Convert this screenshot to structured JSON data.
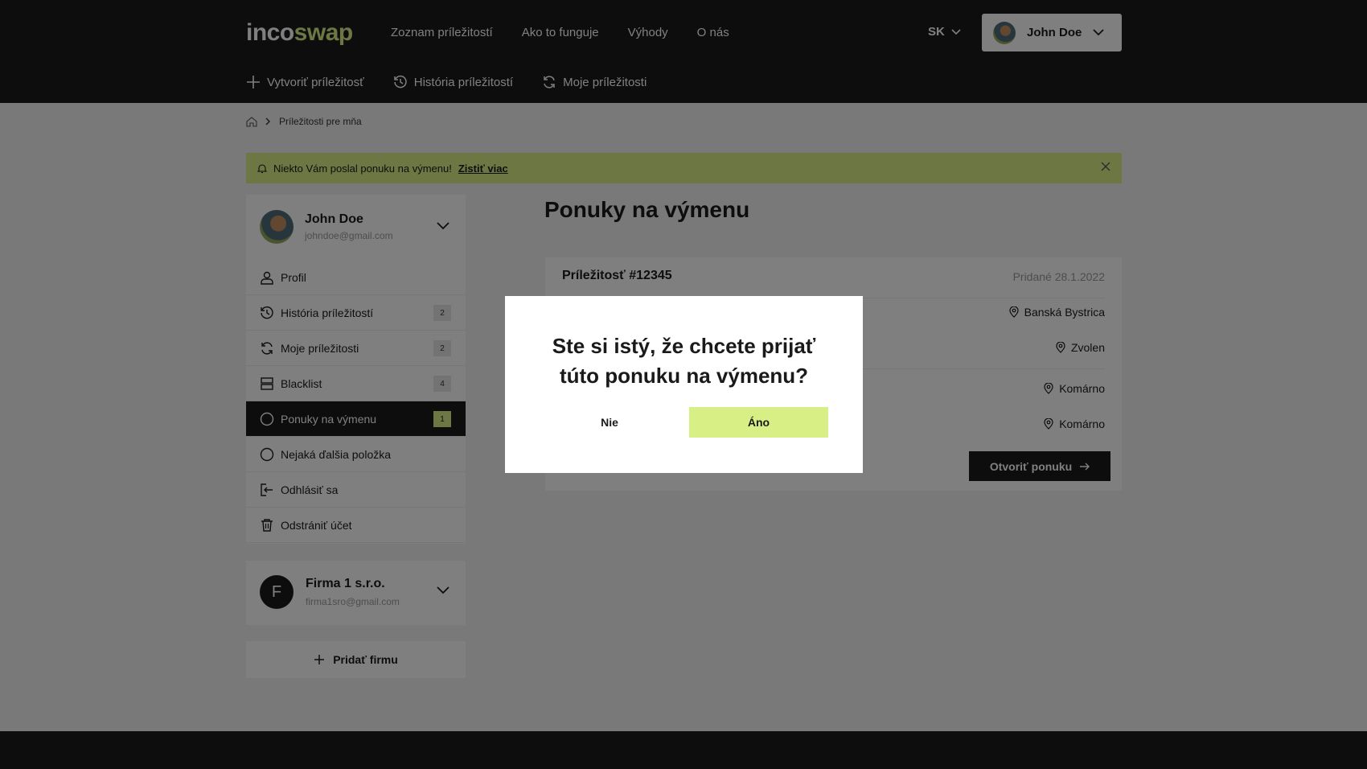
{
  "header": {
    "logo_part1": "inco",
    "logo_part2": "swap",
    "nav": [
      "Zoznam príležitostí",
      "Ako to funguje",
      "Výhody",
      "O nás"
    ],
    "language": "SK",
    "user_name": "John Doe",
    "subnav": {
      "create": "Vytvoriť príležitosť",
      "history": "História príležitostí",
      "mine": "Moje príležitosti"
    }
  },
  "breadcrumb": {
    "current": "Príležitosti pre mňa"
  },
  "alert": {
    "text": "Niekto Vám poslal ponuku na výmenu!",
    "link": "Zistiť viac"
  },
  "profile": {
    "name": "John Doe",
    "email": "johndoe@gmail.com"
  },
  "menu": {
    "profile": "Profil",
    "history": "História príležitostí",
    "history_count": "2",
    "mine": "Moje príležitosti",
    "mine_count": "2",
    "blacklist": "Blacklist",
    "blacklist_count": "4",
    "offers": "Ponuky na výmenu",
    "offers_count": "1",
    "other": "Nejaká ďalšia položka",
    "logout": "Odhlásiť sa",
    "delete": "Odstrániť účet"
  },
  "firm": {
    "initial": "F",
    "name": "Firma 1 s.r.o.",
    "email": "firma1sro@gmail.com"
  },
  "add_firm": "Pridať firmu",
  "main": {
    "title": "Ponuky na výmenu",
    "offer": {
      "title": "Príležitosť #12345",
      "date": "Pridané 28.1.2022",
      "locations": [
        "Banská Bystrica",
        "Zvolen",
        "Komárno",
        "Komárno"
      ],
      "open_button": "Otvoriť ponuku"
    }
  },
  "modal": {
    "question_line1": "Ste si istý, že chcete prijať",
    "question_line2": "túto ponuku na výmenu?",
    "no": "Nie",
    "yes": "Áno"
  },
  "colors": {
    "accent": "#d8ef86",
    "dark": "#1b1b1b"
  }
}
